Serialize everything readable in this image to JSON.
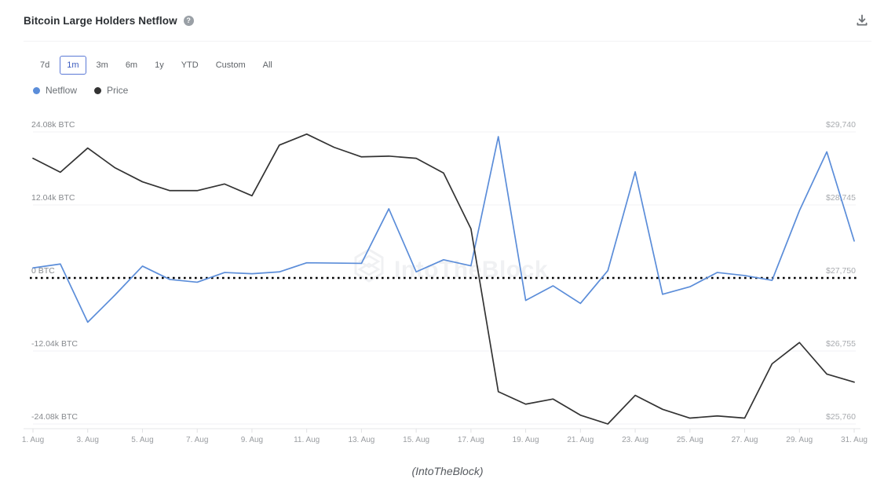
{
  "header": {
    "title": "Bitcoin Large Holders Netflow",
    "help_icon": "question-mark-icon",
    "help_glyph": "?",
    "download_icon": "download-icon"
  },
  "range_selector": {
    "options": [
      "7d",
      "1m",
      "3m",
      "6m",
      "1y",
      "YTD",
      "Custom",
      "All"
    ],
    "selected": "1m",
    "accent": "#5b79d6"
  },
  "legend": {
    "items": [
      {
        "label": "Netflow",
        "color": "#5b8dd9"
      },
      {
        "label": "Price",
        "color": "#333333"
      }
    ]
  },
  "watermark": {
    "text": "IntoTheBlock",
    "logo": "hexagon-logo-icon"
  },
  "source": {
    "text": "(IntoTheBlock)"
  },
  "chart_data": {
    "type": "line",
    "title": "Bitcoin Large Holders Netflow",
    "xlabel": "",
    "ylabel": "Netflow (BTC)",
    "y2label": "Price (USD)",
    "grid": true,
    "legend_position": "top-left",
    "x": [
      "1. Aug",
      "2. Aug",
      "3. Aug",
      "4. Aug",
      "5. Aug",
      "6. Aug",
      "7. Aug",
      "8. Aug",
      "9. Aug",
      "10. Aug",
      "11. Aug",
      "12. Aug",
      "13. Aug",
      "14. Aug",
      "15. Aug",
      "16. Aug",
      "17. Aug",
      "18. Aug",
      "19. Aug",
      "20. Aug",
      "21. Aug",
      "22. Aug",
      "23. Aug",
      "24. Aug",
      "25. Aug",
      "26. Aug",
      "27. Aug",
      "28. Aug",
      "29. Aug",
      "30. Aug",
      "31. Aug"
    ],
    "xticklabels": [
      "1. Aug",
      "3. Aug",
      "5. Aug",
      "7. Aug",
      "9. Aug",
      "11. Aug",
      "13. Aug",
      "15. Aug",
      "17. Aug",
      "19. Aug",
      "21. Aug",
      "23. Aug",
      "25. Aug",
      "27. Aug",
      "29. Aug",
      "31. Aug"
    ],
    "yticklabels": [
      "24.08k BTC",
      "12.04k BTC",
      "0 BTC",
      "-12.04k BTC",
      "-24.08k BTC"
    ],
    "ytickvalues": [
      24080,
      12040,
      0,
      -12040,
      -24080
    ],
    "ylim": [
      -24080,
      24080
    ],
    "y2ticklabels": [
      "$29,740",
      "$28,745",
      "$27,750",
      "$26,755",
      "$25,760"
    ],
    "y2tickvalues": [
      29740,
      28745,
      27750,
      26755,
      25760
    ],
    "y2lim": [
      25760,
      29740
    ],
    "zero_line": {
      "value": 0,
      "style": "dotted",
      "color": "#000000"
    },
    "series": [
      {
        "name": "Netflow",
        "color": "#5b8dd9",
        "axis": "left",
        "unit": "BTC",
        "values": [
          1650,
          2300,
          -7300,
          -2800,
          1950,
          -250,
          -700,
          900,
          700,
          1000,
          2500,
          2450,
          2400,
          11400,
          1000,
          3000,
          2000,
          23300,
          -3700,
          -1300,
          -4200,
          1200,
          17500,
          -2700,
          -1450,
          900,
          400,
          -400,
          11100,
          20800,
          6100
        ]
      },
      {
        "name": "Price",
        "color": "#333333",
        "axis": "right",
        "unit": "USD",
        "values": [
          29380,
          29190,
          29520,
          29250,
          29060,
          28940,
          28940,
          29030,
          28870,
          29560,
          29710,
          29530,
          29400,
          29410,
          29380,
          29180,
          28420,
          26200,
          26030,
          26100,
          25880,
          25760,
          26150,
          25960,
          25840,
          25870,
          25840,
          26580,
          26870,
          26440,
          26330
        ]
      }
    ]
  }
}
